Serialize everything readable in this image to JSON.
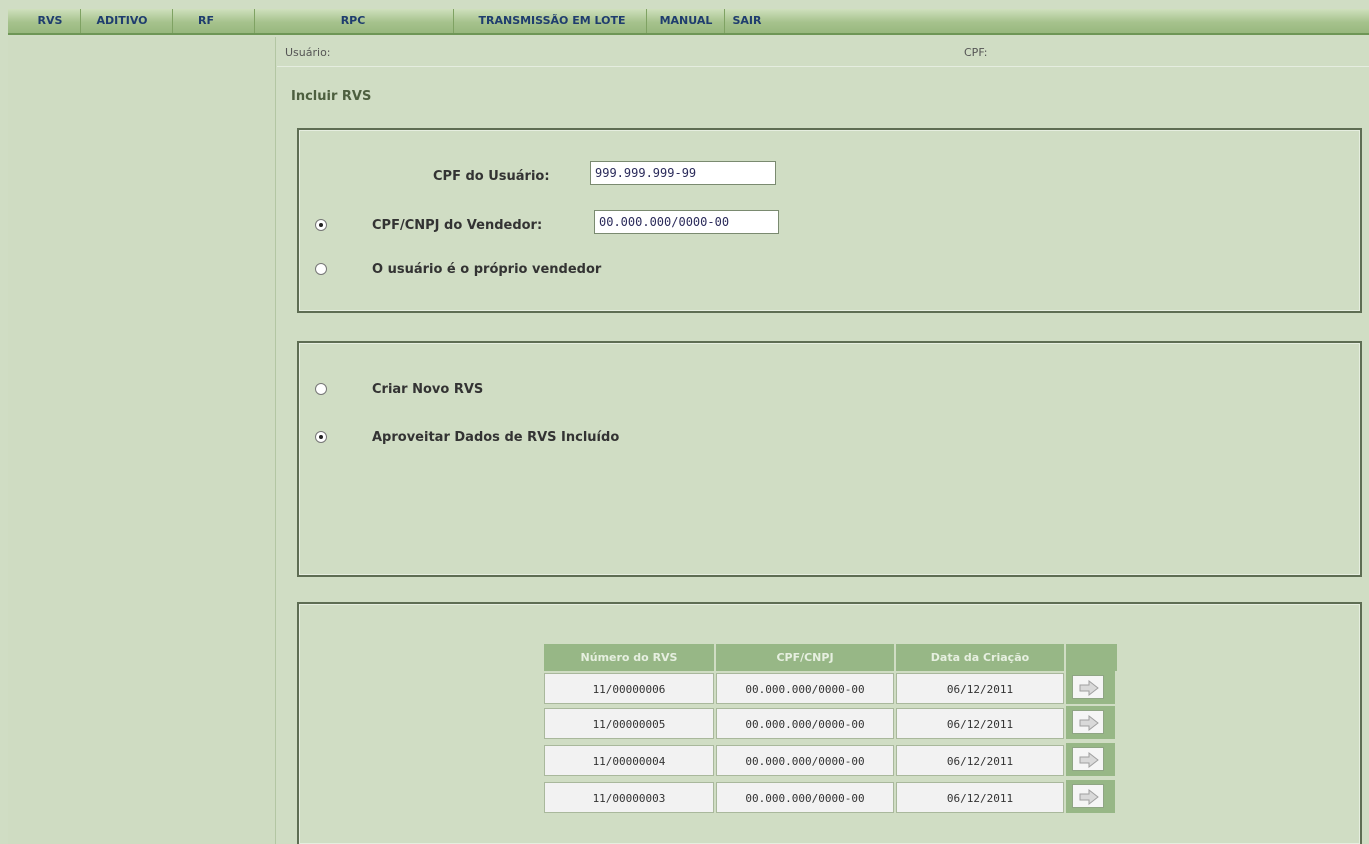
{
  "menu": {
    "items": [
      "RVS",
      "ADITIVO",
      "RF",
      "RPC",
      "TRANSMISSÃO EM LOTE",
      "MANUAL",
      "SAIR"
    ]
  },
  "userbar": {
    "user_label": "Usuário:",
    "cpf_label": "CPF:"
  },
  "page": {
    "title": "Incluir RVS"
  },
  "vendor_panel": {
    "cpf_user_label": "CPF do Usuário:",
    "cpf_user_value": "999.999.999-99",
    "seller_option_label": "CPF/CNPJ do Vendedor:",
    "seller_value": "00.000.000/0000-00",
    "self_seller_label": "O usuário é o próprio vendedor",
    "selected": "seller"
  },
  "mode_panel": {
    "new_label": "Criar Novo RVS",
    "reuse_label": "Aproveitar Dados de RVS Incluído",
    "selected": "reuse"
  },
  "table": {
    "headers": [
      "Número do RVS",
      "CPF/CNPJ",
      "Data da Criação",
      ""
    ],
    "rows": [
      {
        "numero": "11/00000006",
        "cpf": "00.000.000/0000-00",
        "data": "06/12/2011"
      },
      {
        "numero": "11/00000005",
        "cpf": "00.000.000/0000-00",
        "data": "06/12/2011"
      },
      {
        "numero": "11/00000004",
        "cpf": "00.000.000/0000-00",
        "data": "06/12/2011"
      },
      {
        "numero": "11/00000003",
        "cpf": "00.000.000/0000-00",
        "data": "06/12/2011"
      }
    ],
    "action_icon": "arrow-right-icon"
  },
  "colors": {
    "background": "#d0ddc4",
    "menu": "#a6c28d",
    "menu_text": "#1f3d6e",
    "header": "#97b786"
  }
}
